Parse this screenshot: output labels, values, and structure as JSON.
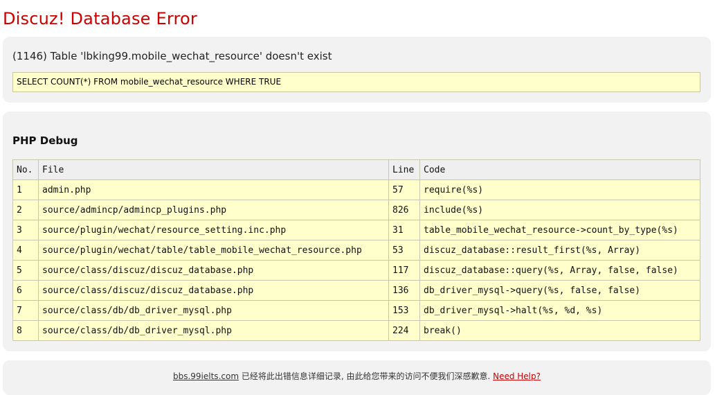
{
  "page": {
    "title": "Discuz! Database Error"
  },
  "error": {
    "message": "(1146) Table 'lbking99.mobile_wechat_resource' doesn't exist",
    "sql": "SELECT COUNT(*) FROM mobile_wechat_resource WHERE TRUE"
  },
  "debug": {
    "heading": "PHP Debug",
    "columns": [
      "No.",
      "File",
      "Line",
      "Code"
    ],
    "rows": [
      {
        "no": "1",
        "file": "admin.php",
        "line": "57",
        "code": "require(%s)"
      },
      {
        "no": "2",
        "file": "source/admincp/admincp_plugins.php",
        "line": "826",
        "code": "include(%s)"
      },
      {
        "no": "3",
        "file": "source/plugin/wechat/resource_setting.inc.php",
        "line": "31",
        "code": "table_mobile_wechat_resource->count_by_type(%s)"
      },
      {
        "no": "4",
        "file": "source/plugin/wechat/table/table_mobile_wechat_resource.php",
        "line": "53",
        "code": "discuz_database::result_first(%s, Array)"
      },
      {
        "no": "5",
        "file": "source/class/discuz/discuz_database.php",
        "line": "117",
        "code": "discuz_database::query(%s, Array, false, false)"
      },
      {
        "no": "6",
        "file": "source/class/discuz/discuz_database.php",
        "line": "136",
        "code": "db_driver_mysql->query(%s, false, false)"
      },
      {
        "no": "7",
        "file": "source/class/db/db_driver_mysql.php",
        "line": "153",
        "code": "db_driver_mysql->halt(%s, %d, %s)"
      },
      {
        "no": "8",
        "file": "source/class/db/db_driver_mysql.php",
        "line": "224",
        "code": "break()"
      }
    ]
  },
  "footer": {
    "site_link": "bbs.99ielts.com",
    "message": " 已经将此出错信息详细记录, 由此给您带来的访问不便我们深感歉意. ",
    "help_link": "Need Help?"
  }
}
